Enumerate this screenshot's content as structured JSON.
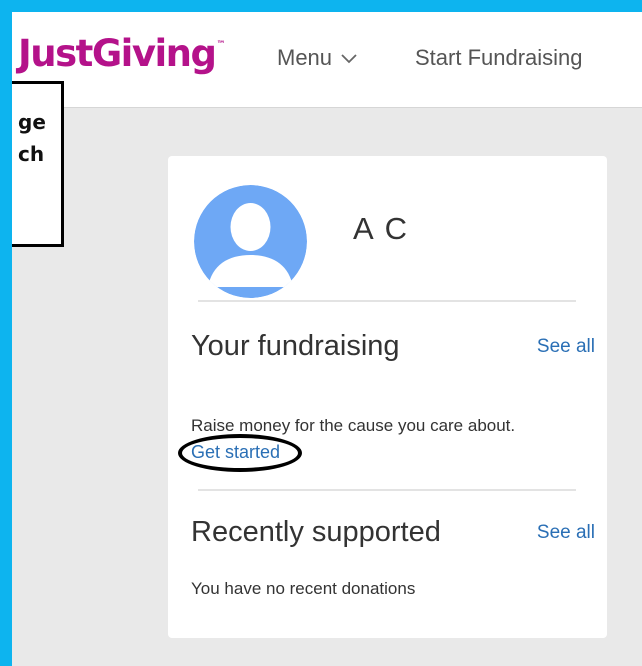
{
  "header": {
    "logo_text": "JustGiving",
    "logo_tm": "™",
    "menu_label": "Menu",
    "start_fundraising_label": "Start Fundraising"
  },
  "callout": {
    "line1": "ge",
    "line2": "ch"
  },
  "profile": {
    "name": "A C"
  },
  "fundraising": {
    "title": "Your fundraising",
    "see_all": "See all",
    "body": "Raise money for the cause you care about.",
    "cta": "Get started"
  },
  "supported": {
    "title": "Recently supported",
    "see_all": "See all",
    "body": "You have no recent donations"
  },
  "colors": {
    "frame_border": "#0db4ef",
    "brand": "#b4128a",
    "link": "#2a6fb5",
    "avatar": "#6ea8f5"
  },
  "icons": {
    "menu_chevron": "chevron-down-icon",
    "avatar": "user-avatar-icon"
  }
}
